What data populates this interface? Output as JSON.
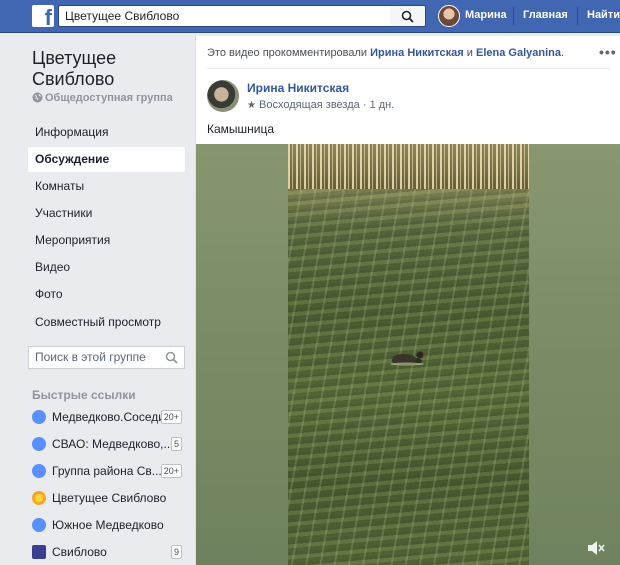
{
  "topbar": {
    "logo": "f",
    "search_value": "Цветущее Свиблово",
    "user_name": "Марина",
    "home": "Главная",
    "find": "Найти"
  },
  "group": {
    "title": "Цветущее Свиблово",
    "type": "Общедоступная группа"
  },
  "nav": {
    "items": [
      {
        "label": "Информация"
      },
      {
        "label": "Обсуждение"
      },
      {
        "label": "Комнаты"
      },
      {
        "label": "Участники"
      },
      {
        "label": "Мероприятия"
      },
      {
        "label": "Видео"
      },
      {
        "label": "Фото"
      },
      {
        "label": "Совместный просмотр"
      }
    ],
    "active": "Обсуждение"
  },
  "group_search": {
    "placeholder": "Поиск в этой группе"
  },
  "quick_links": {
    "header": "Быстрые ссылки",
    "items": [
      {
        "label": "Медведково.Соседи.",
        "badge": "20+"
      },
      {
        "label": "СВАО: Медведково,...",
        "badge": "5"
      },
      {
        "label": "Группа района Св...",
        "badge": "20+"
      },
      {
        "label": "Цветущее Свиблово",
        "badge": ""
      },
      {
        "label": "Южное Медведково",
        "badge": ""
      },
      {
        "label": "Свиблово",
        "badge": "9"
      }
    ]
  },
  "post": {
    "header_prefix": "Это видео прокомментировали",
    "commenter_1": "Ирина Никитская",
    "conjunction": "и",
    "commenter_2": "Elena Galyanina",
    "header_suffix": ".",
    "more": "•••",
    "author": "Ирина Никитская",
    "badge": "Восходящая звезда",
    "separator": "·",
    "time": "1 дн.",
    "text": "Камышница"
  },
  "colors": {
    "brand": "#4267b2",
    "link": "#365899",
    "background": "#e9ebee"
  },
  "icons": [
    "search-icon",
    "globe-icon",
    "group-icon",
    "star-icon",
    "volume-muted-icon"
  ]
}
